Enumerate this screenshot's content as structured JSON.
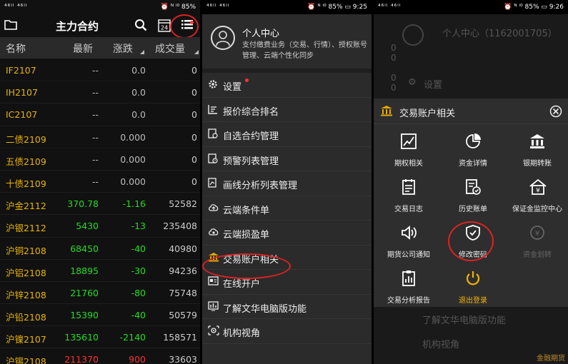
{
  "status": {
    "p1": {
      "left": "⁴⁶ˡˡ ⁴⁶ˡˡ",
      "right": "⏰ ᴺ ⁱ⁰ 85%"
    },
    "p2": {
      "left": "⁴⁶ˡˡ ⁴⁶ˡˡ",
      "right": "⏰ ᴺ ⁱ⁰ 85% ▭ 9:25"
    },
    "p3": {
      "left": "⁴⁶ˡˡ ⁴⁶ˡˡ",
      "right": "⏰ ᴺ ⁱ⁰ 85% ▭ 9:26"
    }
  },
  "quotes": {
    "title": "主力合约",
    "columns": [
      "名称",
      "最新",
      "涨跌",
      "成交量"
    ],
    "rows": [
      {
        "name": "IF2107",
        "last": "--",
        "chg": "0.0",
        "vol": "0",
        "dir": "flat"
      },
      {
        "name": "IH2107",
        "last": "--",
        "chg": "0.0",
        "vol": "0",
        "dir": "flat"
      },
      {
        "name": "IC2107",
        "last": "--",
        "chg": "0.0",
        "vol": "0",
        "dir": "flat"
      },
      {
        "name": "二债2109",
        "last": "--",
        "chg": "0.000",
        "vol": "0",
        "dir": "flat"
      },
      {
        "name": "五债2109",
        "last": "--",
        "chg": "0.000",
        "vol": "0",
        "dir": "flat"
      },
      {
        "name": "十债2109",
        "last": "--",
        "chg": "0.000",
        "vol": "0",
        "dir": "flat"
      },
      {
        "name": "沪金2112",
        "last": "370.78",
        "chg": "-1.16",
        "vol": "52582",
        "dir": "down"
      },
      {
        "name": "沪银2112",
        "last": "5430",
        "chg": "-13",
        "vol": "235408",
        "dir": "down"
      },
      {
        "name": "沪铜2108",
        "last": "68450",
        "chg": "-40",
        "vol": "40980",
        "dir": "down"
      },
      {
        "name": "沪铝2108",
        "last": "18895",
        "chg": "-30",
        "vol": "94236",
        "dir": "down"
      },
      {
        "name": "沪锌2108",
        "last": "21760",
        "chg": "-80",
        "vol": "75748",
        "dir": "down"
      },
      {
        "name": "沪铅2108",
        "last": "15390",
        "chg": "-40",
        "vol": "50579",
        "dir": "down"
      },
      {
        "name": "沪镍2107",
        "last": "135610",
        "chg": "-2140",
        "vol": "158571",
        "dir": "down"
      },
      {
        "name": "沪锡2108",
        "last": "211370",
        "chg": "900",
        "vol": "33603",
        "dir": "up"
      }
    ]
  },
  "menu": {
    "profile_name": "个人中心",
    "profile_desc": "支付缴费业务（交易、行情）、授权账号管理、云端个性化同步",
    "items": [
      {
        "label": "设置",
        "icon": "gear-icon"
      },
      {
        "label": "报价综合排名",
        "icon": "ranking-icon"
      },
      {
        "label": "自选合约管理",
        "icon": "watchlist-icon"
      },
      {
        "label": "预警列表管理",
        "icon": "alert-list-icon"
      },
      {
        "label": "画线分析列表管理",
        "icon": "line-analysis-icon"
      },
      {
        "label": "云端条件单",
        "icon": "cloud-order-icon"
      },
      {
        "label": "云端损盈单",
        "icon": "cloud-stop-icon"
      },
      {
        "label": "交易账户相关",
        "icon": "bank-icon"
      },
      {
        "label": "在线开户",
        "icon": "id-card-icon"
      },
      {
        "label": "了解文华电脑版功能",
        "icon": "chart-board-icon"
      },
      {
        "label": "机构视角",
        "icon": "eye-icon"
      }
    ]
  },
  "account_modal": {
    "bg_profile": "个人中心（1162001705）",
    "bg_settings": "设置",
    "bg_item1": "了解文华电脑版功能",
    "bg_item2": "机构视角",
    "title": "交易账户相关",
    "items": [
      {
        "label": "期权相关",
        "icon": "option-chart-icon"
      },
      {
        "label": "资金详情",
        "icon": "pie-chart-icon"
      },
      {
        "label": "银期转账",
        "icon": "bank-transfer-icon"
      },
      {
        "label": "交易日志",
        "icon": "log-icon"
      },
      {
        "label": "历史账单",
        "icon": "bill-history-icon"
      },
      {
        "label": "保证金监控中心",
        "icon": "margin-house-icon"
      },
      {
        "label": "期货公司通知",
        "icon": "speaker-icon"
      },
      {
        "label": "修改密码",
        "icon": "shield-check-icon"
      },
      {
        "label": "资金划转",
        "icon": "transfer-icon"
      },
      {
        "label": "交易分析报告",
        "icon": "report-icon"
      },
      {
        "label": "退出登录",
        "icon": "power-icon"
      }
    ]
  },
  "watermark": "金融期货"
}
